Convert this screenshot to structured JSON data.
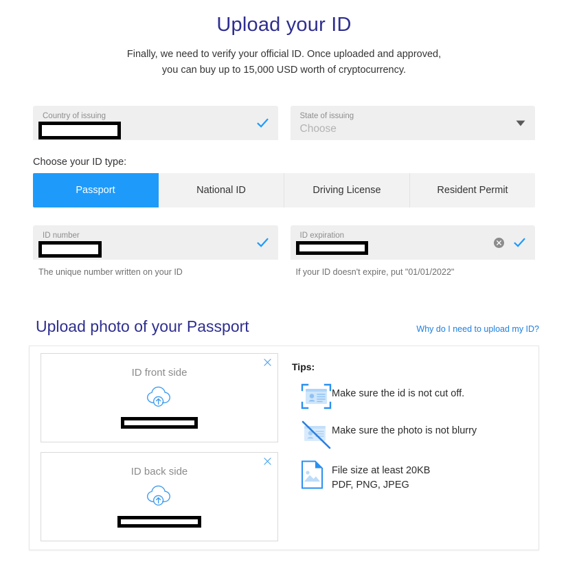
{
  "header": {
    "title": "Upload your ID",
    "subtitle_line1": "Finally, we need to verify your official ID. Once uploaded and approved,",
    "subtitle_line2": "you can buy up to 15,000 USD worth of cryptocurrency."
  },
  "colors": {
    "title": "#2e2e8f",
    "accent_blue": "#1e9bfa",
    "link_blue": "#1e7fe0",
    "field_bg": "#efefef",
    "tab_bg": "#f2f2f2",
    "icon_light_blue": "#bcdcf8",
    "redaction": "#000000"
  },
  "form": {
    "country": {
      "label": "Country of issuing",
      "value": "",
      "redacted": true,
      "valid_icon": "check-icon"
    },
    "state": {
      "label": "State of issuing",
      "placeholder": "Choose",
      "value": "",
      "dropdown_icon": "chevron-down-icon"
    },
    "id_type": {
      "section_label": "Choose your ID type:",
      "selected": "Passport",
      "options": [
        "Passport",
        "National ID",
        "Driving License",
        "Resident Permit"
      ]
    },
    "id_number": {
      "label": "ID number",
      "value": "",
      "redacted": true,
      "help": "The unique number written on your ID",
      "valid_icon": "check-icon"
    },
    "id_expiration": {
      "label": "ID expiration",
      "value": "",
      "redacted": true,
      "help": "If your ID doesn't expire, put \"01/01/2022\"",
      "clear_icon": "clear-circle-icon",
      "valid_icon": "check-icon"
    }
  },
  "upload": {
    "title": "Upload photo of your Passport",
    "help_link": "Why do I need to upload my ID?",
    "dropzones": [
      {
        "title": "ID front side",
        "icon": "cloud-upload-icon",
        "filename": "",
        "redacted": true,
        "close_icon": "close-icon"
      },
      {
        "title": "ID back side",
        "icon": "cloud-upload-icon",
        "filename": "",
        "redacted": true,
        "close_icon": "close-icon"
      }
    ],
    "tips": {
      "title": "Tips:",
      "items": [
        {
          "icon": "id-card-framed-icon",
          "line1": "Make sure the id is not cut off.",
          "line2": ""
        },
        {
          "icon": "id-card-blurry-crossed-icon",
          "line1": "Make sure the photo is not blurry",
          "line2": ""
        },
        {
          "icon": "image-file-icon",
          "line1": "File size at least 20KB",
          "line2": "PDF, PNG, JPEG"
        }
      ]
    }
  }
}
